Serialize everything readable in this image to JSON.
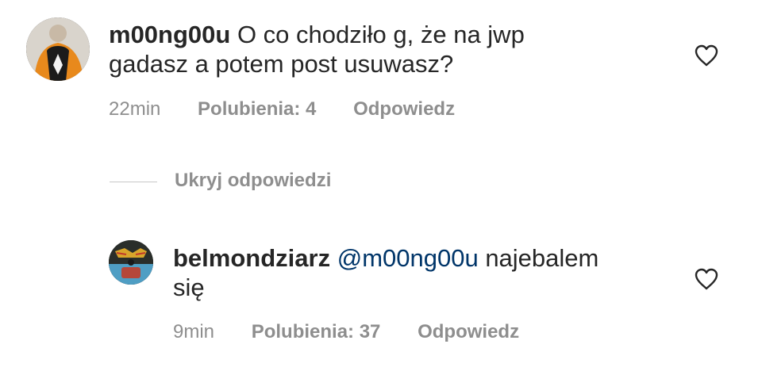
{
  "comments": [
    {
      "username": "m00ng00u",
      "text": " O co chodziło g, że na jwp",
      "text_line2": "gadasz a potem post usuwasz?",
      "time": "22min",
      "likes": "Polubienia: 4",
      "reply": "Odpowiedz",
      "avatar_icon": "user-avatar-orange-hoodie",
      "like_icon": "heart-outline-icon"
    },
    {
      "username": "belmondziarz",
      "mention": "@m00ng00u",
      "text": " najebalem",
      "text_line2": "się",
      "time": "9min",
      "likes": "Polubienia: 37",
      "reply": "Odpowiedz",
      "avatar_icon": "user-avatar-mask",
      "like_icon": "heart-outline-icon"
    }
  ],
  "replies_toggle": "Ukryj odpowiedzi",
  "colors": {
    "text": "#262626",
    "meta": "#8e8e8e",
    "mention": "#003569",
    "divider": "#c7c7c7"
  }
}
